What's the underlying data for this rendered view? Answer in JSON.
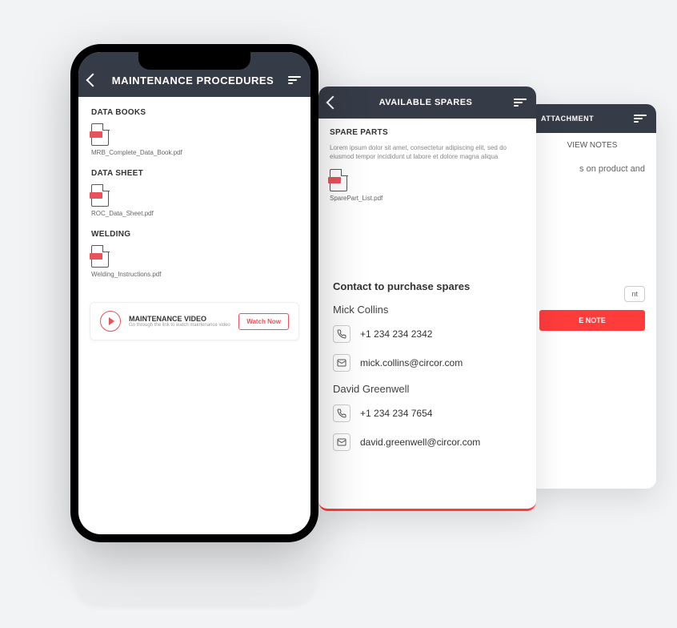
{
  "screen1": {
    "title": "MAINTENANCE PROCEDURES",
    "sections": [
      {
        "label": "DATA BOOKS",
        "file": "MRB_Complete_Data_Book.pdf"
      },
      {
        "label": "DATA SHEET",
        "file": "ROC_Data_Sheet.pdf"
      },
      {
        "label": "WELDING",
        "file": "Welding_Instructions.pdf"
      }
    ],
    "video": {
      "title": "MAINTENANCE VIDEO",
      "sub": "Go through the link to watch maintenance video",
      "button": "Watch Now"
    }
  },
  "screen2": {
    "title": "AVAILABLE SPARES",
    "section_label": "SPARE PARTS",
    "section_desc": "Lorem ipsum dolor sit amet, consectetur adipiscing elit, sed do eiusmod tempor incididunt ut labore et dolore magna aliqua",
    "file": "SparePart_List.pdf",
    "contact_header": "Contact to purchase spares",
    "contacts": [
      {
        "name": "Mick Collins",
        "phone": "+1 234 234 2342",
        "email": "mick.collins@circor.com"
      },
      {
        "name": "David Greenwell",
        "phone": "+1 234 234 7654",
        "email": "david.greenwell@circor.com"
      }
    ]
  },
  "screen3": {
    "title": "ATTACHMENT",
    "tab": "VIEW NOTES",
    "notes_fragment": "s on product and",
    "attach_fragment": "nt",
    "button_fragment": "E NOTE"
  }
}
